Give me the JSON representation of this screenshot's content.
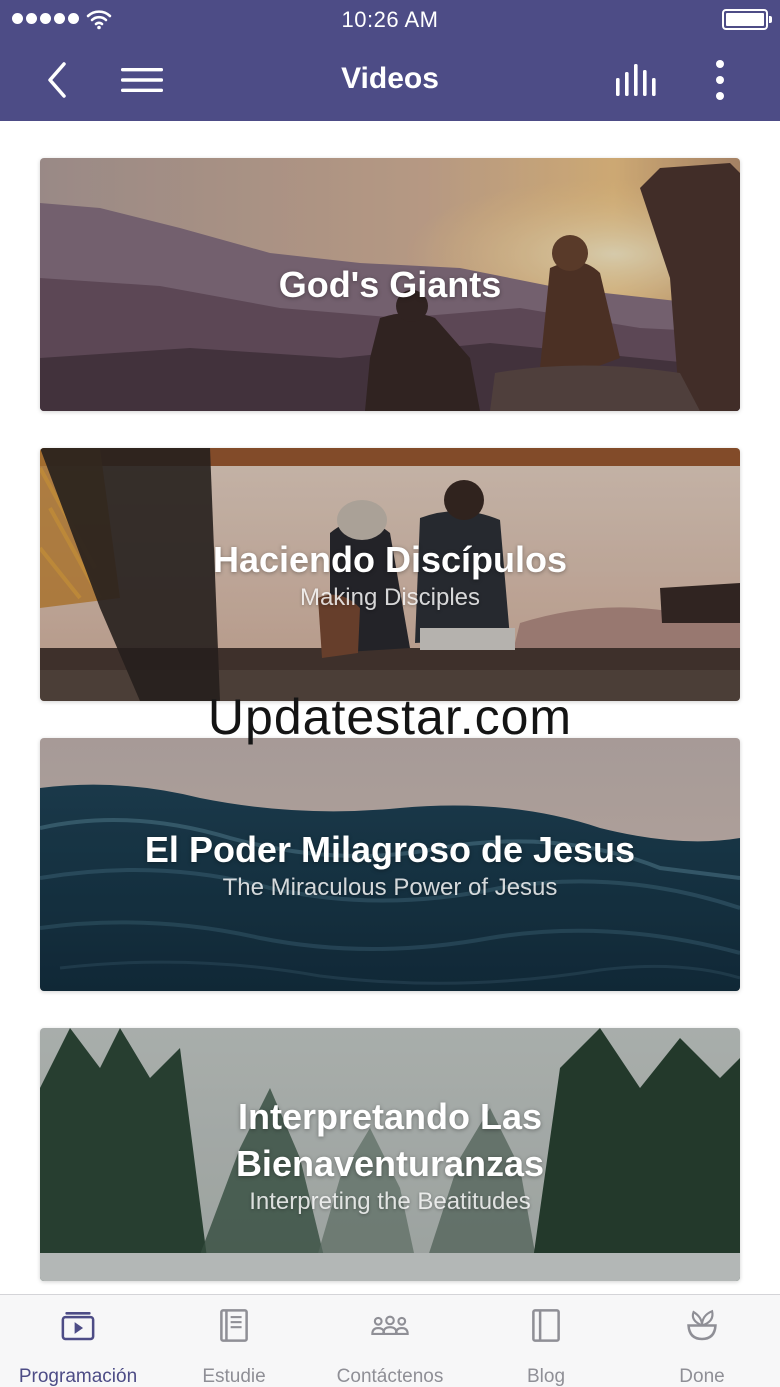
{
  "status_bar": {
    "time": "10:26 AM"
  },
  "nav": {
    "title": "Videos"
  },
  "cards": [
    {
      "title": "God's Giants",
      "subtitle": ""
    },
    {
      "title": "Haciendo Discípulos",
      "subtitle": "Making Disciples"
    },
    {
      "title": "El Poder Milagroso de Jesus",
      "subtitle": "The Miraculous Power of Jesus"
    },
    {
      "title": "Interpretando Las Bienaventuranzas",
      "subtitle": "Interpreting the Beatitudes"
    }
  ],
  "watermark": "Updatestar.com",
  "tabs": [
    {
      "label": "Programación",
      "icon": "video-play-icon",
      "active": true
    },
    {
      "label": "Estudie",
      "icon": "book-icon",
      "active": false
    },
    {
      "label": "Contáctenos",
      "icon": "people-icon",
      "active": false
    },
    {
      "label": "Blog",
      "icon": "blog-icon",
      "active": false
    },
    {
      "label": "Done",
      "icon": "plant-icon",
      "active": false
    }
  ],
  "colors": {
    "header": "#4d4c86",
    "active_tab": "#4d4c86",
    "inactive_tab": "#8f8f96"
  }
}
